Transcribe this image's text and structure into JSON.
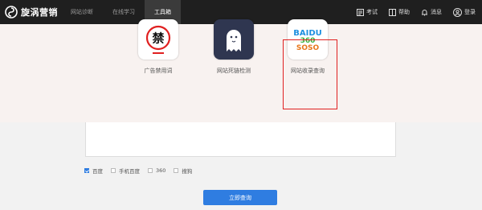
{
  "brand": {
    "name": "旋涡营销"
  },
  "nav": {
    "items": [
      {
        "label": "网站诊断"
      },
      {
        "label": "在线学习"
      },
      {
        "label": "工具箱"
      }
    ],
    "active_index": 2
  },
  "user_nav": {
    "exam": "考试",
    "help": "帮助",
    "messages": "消息",
    "login": "登录"
  },
  "tools": [
    {
      "label": "广告禁用词",
      "icon": "ban-word-icon",
      "glyph": "禁"
    },
    {
      "label": "网站死链检测",
      "icon": "ghost-icon"
    },
    {
      "label": "网站收录查询",
      "icon": "baidu-360-soso-icon",
      "lines": [
        "BAIDU",
        "360",
        "SOSO"
      ]
    }
  ],
  "engines": [
    {
      "label": "百度",
      "checked": true
    },
    {
      "label": "手机百度",
      "checked": false
    },
    {
      "label": "360",
      "checked": false
    },
    {
      "label": "搜狗",
      "checked": false
    }
  ],
  "query_button": "立即查询",
  "colors": {
    "accent": "#2f7de1",
    "highlight": "#e02020",
    "topbar": "#1f1f1f"
  }
}
